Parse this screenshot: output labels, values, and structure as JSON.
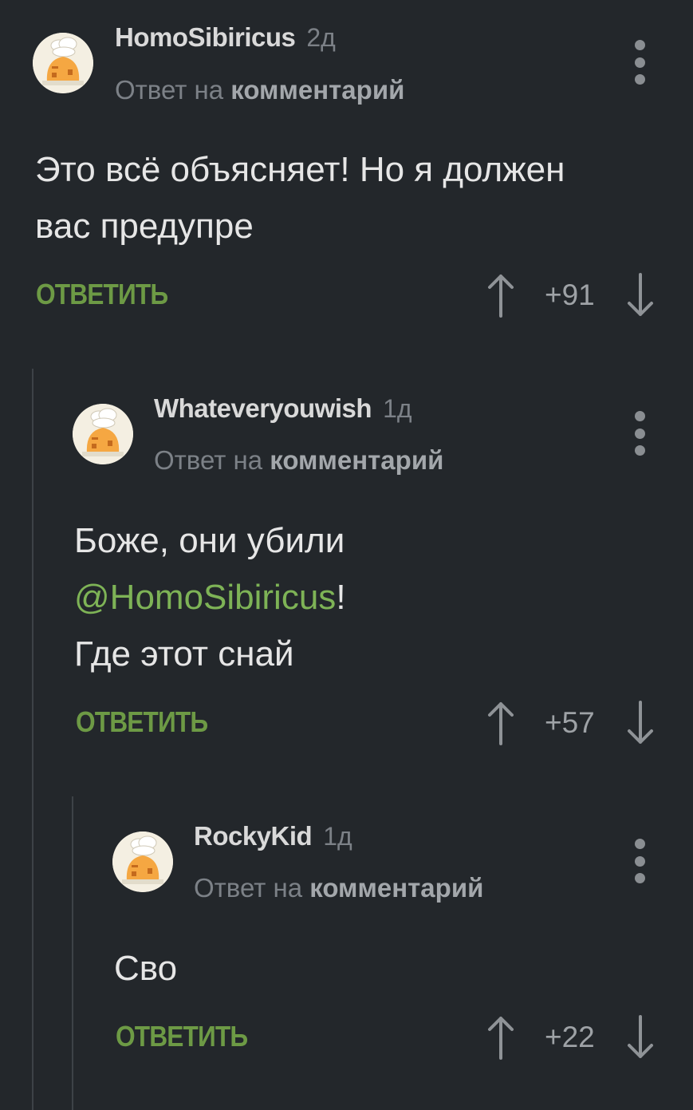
{
  "comments": [
    {
      "author": "HomoSibiricus",
      "age": "2д",
      "reply_prefix": "Ответ на",
      "reply_target": "комментарий",
      "body_lines": [
        "Это всё объясняет! Но я должен",
        "вас предупре"
      ],
      "reply_label": "ОТВЕТИТЬ",
      "score": "+91"
    },
    {
      "author": "Whateveryouwish",
      "age": "1д",
      "reply_prefix": "Ответ на",
      "reply_target": "комментарий",
      "body_line1": "Боже, они убили",
      "mention": "@HomoSibiricus",
      "mention_suffix": "!",
      "body_line3": "Где этот снай",
      "reply_label": "ОТВЕТИТЬ",
      "score": "+57"
    },
    {
      "author": "RockyKid",
      "age": "1д",
      "reply_prefix": "Ответ на",
      "reply_target": "комментарий",
      "body_lines": [
        "Сво"
      ],
      "reply_label": "ОТВЕТИТЬ",
      "score": "+22"
    }
  ],
  "colors": {
    "background": "#23272b",
    "accent_green": "#6d9a45",
    "mention_green": "#7eb356",
    "muted_text": "#7c8187"
  },
  "icons": {
    "avatar": "default-chef-avatar-icon",
    "more": "more-vertical-icon",
    "upvote": "arrow-up-icon",
    "downvote": "arrow-down-icon"
  }
}
